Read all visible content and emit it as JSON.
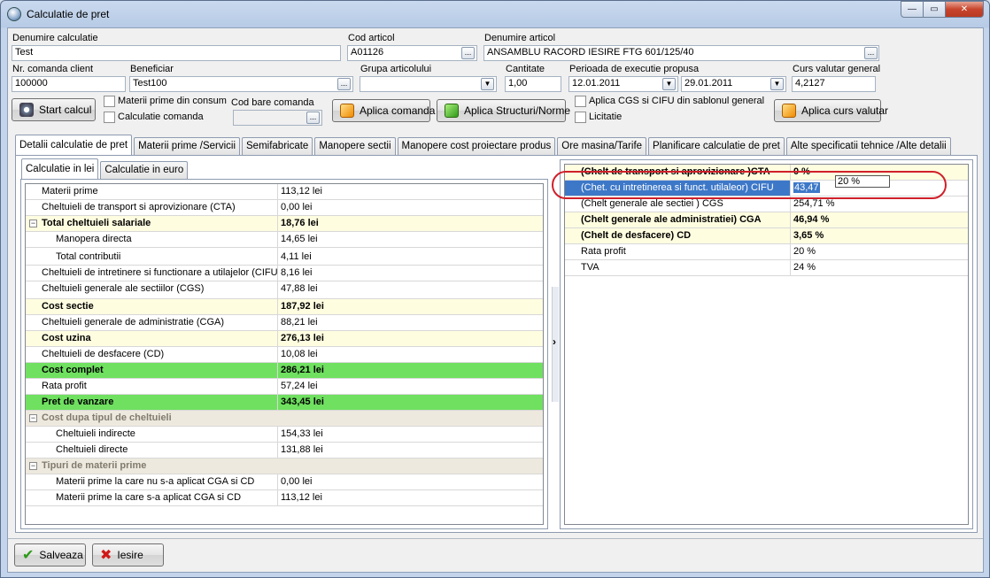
{
  "window": {
    "title": "Calculatie de pret"
  },
  "header": {
    "denumire_calculatie": {
      "label": "Denumire calculatie",
      "value": "Test"
    },
    "cod_articol": {
      "label": "Cod articol",
      "value": "A01126"
    },
    "denumire_articol": {
      "label": "Denumire articol",
      "value": "ANSAMBLU RACORD IESIRE FTG 601/125/40"
    },
    "nr_comanda_client": {
      "label": "Nr. comanda client",
      "value": "100000"
    },
    "beneficiar": {
      "label": "Beneficiar",
      "value": "Test100"
    },
    "grupa_articolului": {
      "label": "Grupa articolului",
      "value": ""
    },
    "cantitate": {
      "label": "Cantitate",
      "value": "1,00"
    },
    "perioada": {
      "label": "Perioada de executie propusa",
      "start": "12.01.2011",
      "end": "29.01.2011"
    },
    "curs_valutar": {
      "label": "Curs valutar general",
      "value": "4,2127"
    },
    "cod_bare": {
      "label": "Cod bare comanda",
      "value": ""
    },
    "checkboxes": {
      "materii_prime_consum": "Materii prime din consum",
      "calculatie_comanda": "Calculatie comanda",
      "aplica_cgs_cifu": "Aplica CGS si CIFU din sablonul general",
      "licitatie": "Licitatie"
    },
    "buttons": {
      "start_calcul": "Start calcul",
      "aplica_comanda": "Aplica comanda",
      "aplica_structuri": "Aplica Structuri/Norme",
      "aplica_curs": "Aplica curs valutar"
    }
  },
  "tabs": [
    "Detalii calculatie de pret",
    "Materii prime /Servicii",
    "Semifabricate",
    "Manopere sectii",
    "Manopere cost proiectare produs",
    "Ore masina/Tarife",
    "Planificare calculatie de pret",
    "Alte specificatii tehnice /Alte detalii"
  ],
  "subtabs": [
    "Calculatie in lei",
    "Calculatie in euro"
  ],
  "left_grid": {
    "rows": [
      {
        "label": "Materii prime",
        "value": "113,12 lei"
      },
      {
        "label": "Cheltuieli de transport si aprovizionare (CTA)",
        "value": "0,00 lei"
      },
      {
        "label": "Total cheltuieli salariale",
        "value": "18,76 lei"
      },
      {
        "label": "Manopera directa",
        "value": "14,65 lei"
      },
      {
        "label": "Total contributii",
        "value": "4,11 lei"
      },
      {
        "label": "Cheltuieli de intretinere si functionare a utilajelor (CIFU)",
        "value": "8,16 lei"
      },
      {
        "label": "Cheltuieli generale ale sectiilor (CGS)",
        "value": "47,88 lei"
      },
      {
        "label": "Cost sectie",
        "value": "187,92 lei"
      },
      {
        "label": "Cheltuieli generale de administratie (CGA)",
        "value": "88,21 lei"
      },
      {
        "label": "Cost uzina",
        "value": "276,13 lei"
      },
      {
        "label": "Cheltuieli de desfacere (CD)",
        "value": "10,08 lei"
      },
      {
        "label": "Cost complet",
        "value": "286,21 lei"
      },
      {
        "label": "Rata profit",
        "value": "57,24 lei"
      },
      {
        "label": "Pret de vanzare",
        "value": "343,45 lei"
      },
      {
        "label": "Cost dupa tipul de cheltuieli",
        "value": ""
      },
      {
        "label": "Cheltuieli indirecte",
        "value": "154,33 lei"
      },
      {
        "label": "Cheltuieli directe",
        "value": "131,88 lei"
      },
      {
        "label": "Tipuri de materii prime",
        "value": ""
      },
      {
        "label": "Materii prime la care nu s-a aplicat CGA si CD",
        "value": "0,00 lei"
      },
      {
        "label": "Materii prime la care s-a aplicat CGA si CD",
        "value": "113,12 lei"
      }
    ],
    "expander_symbol": "−"
  },
  "right_grid": {
    "rows": [
      {
        "label": "(Chelt de transport si aprovizionare )CTA",
        "value": "0 %"
      },
      {
        "label": "(Chet. cu intretinerea si funct. utilaleor) CIFU",
        "value": "43,47"
      },
      {
        "label": "(Chelt generale ale sectiei ) CGS",
        "value": "254,71 %"
      },
      {
        "label": "(Chelt generale ale administratiei) CGA",
        "value": "46,94 %"
      },
      {
        "label": "(Chelt de desfacere) CD",
        "value": "3,65 %"
      },
      {
        "label": "Rata profit",
        "value": "20 %"
      },
      {
        "label": "TVA",
        "value": "24 %"
      }
    ],
    "edit_popup_value": "20 %"
  },
  "bottom": {
    "save": "Salveaza",
    "exit": "Iesire"
  },
  "icons": {
    "ellipsis": "...",
    "dropdown": "▼",
    "splitter_arrow": "›",
    "min": "—",
    "max": "▭",
    "close": "✕"
  }
}
